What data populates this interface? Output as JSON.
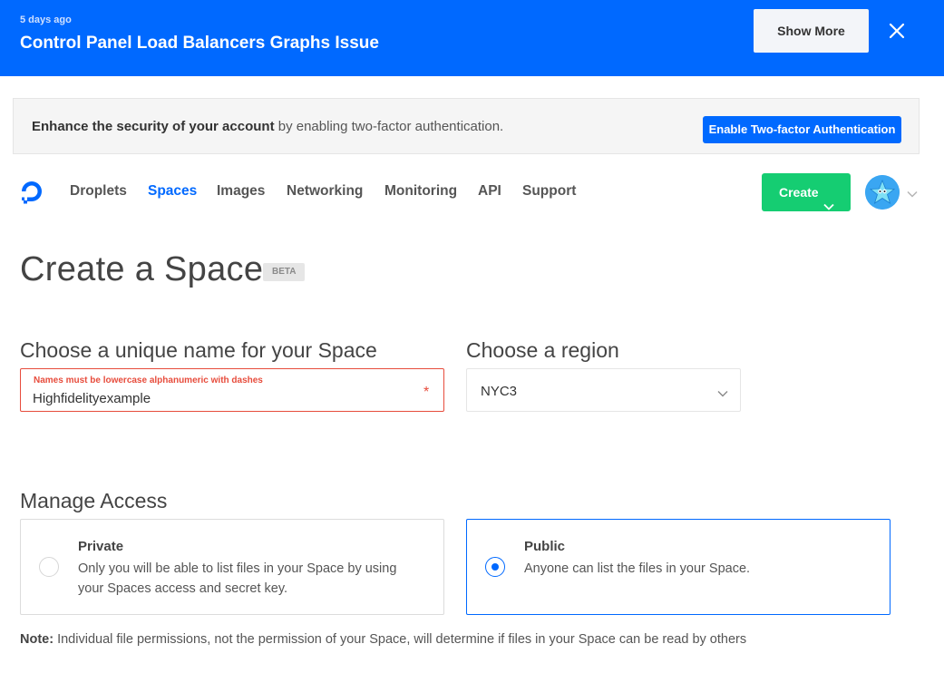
{
  "banner": {
    "time": "5 days ago",
    "title": "Control Panel Load Balancers Graphs Issue",
    "show_more_label": "Show More"
  },
  "security_notice": {
    "bold_text": "Enhance the security of your account",
    "text": " by enabling two-factor authentication.",
    "button_label": "Enable Two-factor Authentication"
  },
  "nav": {
    "items": [
      {
        "label": "Droplets"
      },
      {
        "label": "Spaces"
      },
      {
        "label": "Images"
      },
      {
        "label": "Networking"
      },
      {
        "label": "Monitoring"
      },
      {
        "label": "API"
      },
      {
        "label": "Support"
      }
    ],
    "active": "Spaces",
    "create_label": "Create"
  },
  "page": {
    "title": "Create a Space",
    "badge": "BETA"
  },
  "name_section": {
    "heading": "Choose a unique name for your Space",
    "error": "Names must be lowercase alphanumeric with dashes",
    "value": "Highfidelityexample",
    "required_marker": "*"
  },
  "region_section": {
    "heading": "Choose a region",
    "selected": "NYC3"
  },
  "access_section": {
    "heading": "Manage Access",
    "options": [
      {
        "title": "Private",
        "description": "Only you will be able to list files in your Space by using your Spaces access and secret key.",
        "selected": false
      },
      {
        "title": "Public",
        "description": "Anyone can list the files in your Space.",
        "selected": true
      }
    ],
    "note_label": "Note:",
    "note_text": " Individual file permissions, not the permission of your Space, will determine if files in your Space can be read by others"
  },
  "colors": {
    "brand_blue": "#0069ff",
    "create_green": "#15cd72",
    "error_red": "#e74c3c"
  },
  "icons": [
    "close-icon",
    "digitalocean-logo-icon",
    "chevron-down-icon",
    "avatar-sammy-icon"
  ]
}
